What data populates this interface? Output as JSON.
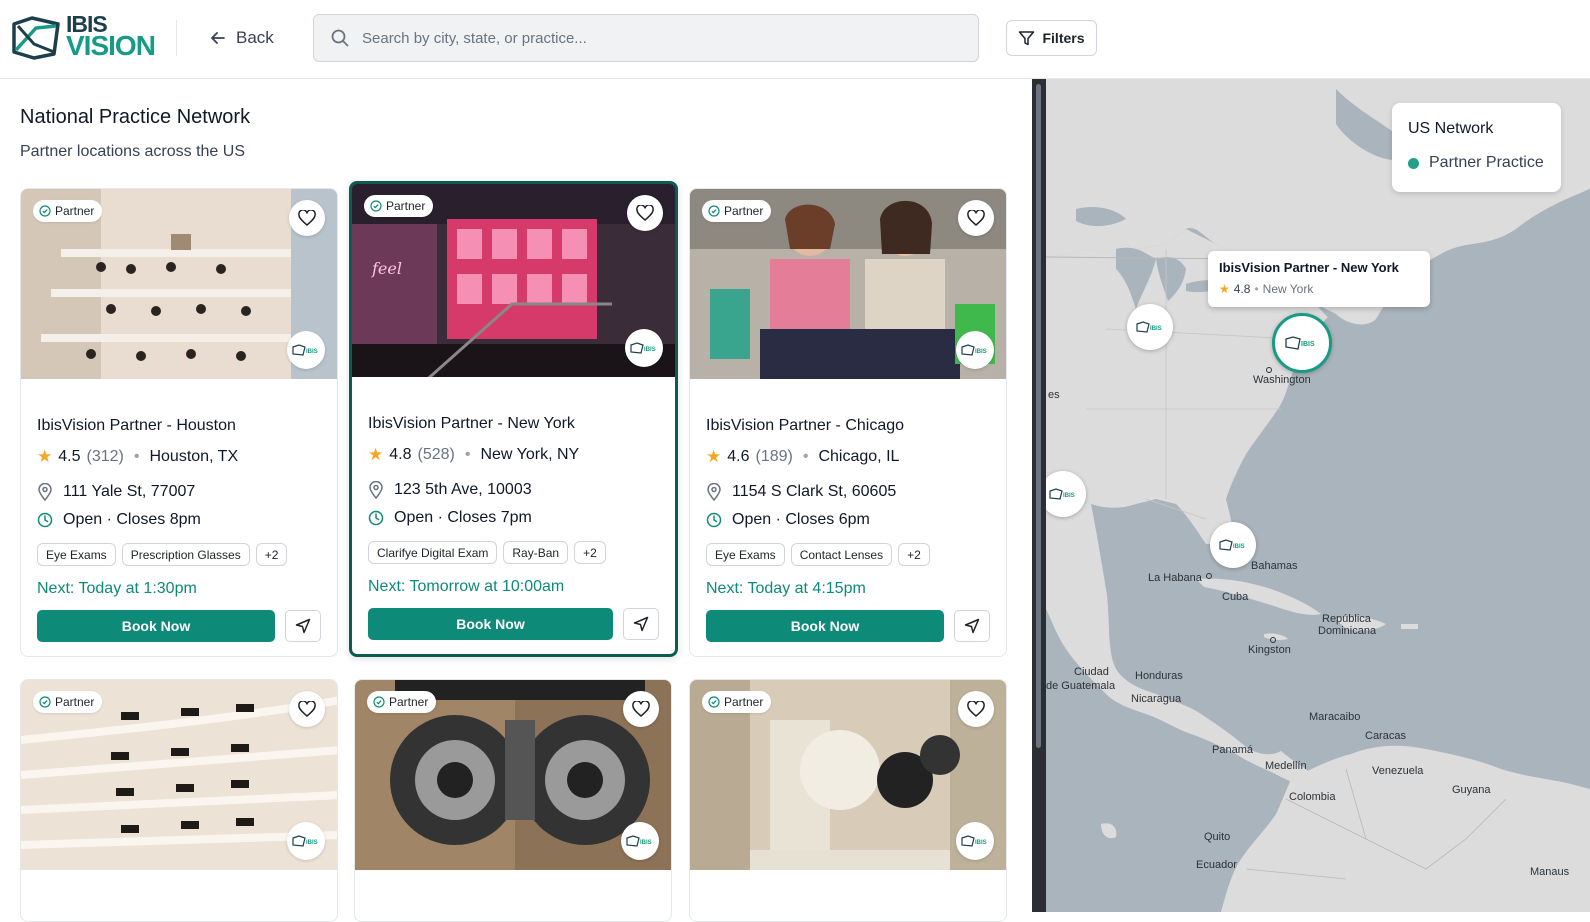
{
  "header": {
    "brand_line1": "IBIS",
    "brand_line2": "VISION",
    "back_label": "Back",
    "search_placeholder": "Search by city, state, or practice...",
    "filters_label": "Filters"
  },
  "page": {
    "title": "National Practice Network",
    "subtitle": "Partner locations across the US"
  },
  "cards": [
    {
      "badge": "Partner",
      "name": "IbisVision Partner - Houston",
      "rating": "4.5",
      "reviews": "(312)",
      "city": "Houston, TX",
      "address": "111 Yale St, 77007",
      "hours": "Open · Closes 8pm",
      "tags": [
        "Eye Exams",
        "Prescription Glasses",
        "+2"
      ],
      "next": "Next: Today at 1:30pm",
      "book_label": "Book Now"
    },
    {
      "badge": "Partner",
      "name": "IbisVision Partner - New York",
      "rating": "4.8",
      "reviews": "(528)",
      "city": "New York, NY",
      "address": "123 5th Ave, 10003",
      "hours": "Open · Closes 7pm",
      "tags": [
        "Clarifye Digital Exam",
        "Ray-Ban",
        "+2"
      ],
      "next": "Next: Tomorrow at 10:00am",
      "book_label": "Book Now"
    },
    {
      "badge": "Partner",
      "name": "IbisVision Partner - Chicago",
      "rating": "4.6",
      "reviews": "(189)",
      "city": "Chicago, IL",
      "address": "1154 S Clark St, 60605",
      "hours": "Open · Closes 6pm",
      "tags": [
        "Eye Exams",
        "Contact Lenses",
        "+2"
      ],
      "next": "Next: Today at 4:15pm",
      "book_label": "Book Now"
    },
    {
      "badge": "Partner"
    },
    {
      "badge": "Partner"
    },
    {
      "badge": "Partner"
    }
  ],
  "map": {
    "legend_title": "US Network",
    "legend_item": "Partner Practice",
    "tooltip": {
      "title": "IbisVision Partner - New York",
      "rating": "4.8",
      "location": "New York"
    },
    "labels": [
      "Washington",
      "La Habana",
      "Cuba",
      "Bahamas",
      "República",
      "Dominicana",
      "Kingston",
      "Ciudad",
      "de Guatemala",
      "Honduras",
      "Nicaragua",
      "Maracaibo",
      "Caracas",
      "Panamá",
      "Medellín",
      "Venezuela",
      "Colombia",
      "Guyana",
      "Quito",
      "Ecuador",
      "Manaus",
      "es"
    ]
  },
  "colors": {
    "brand": "#0e8a78",
    "selected_border": "#0b5d50",
    "star": "#f5a623",
    "map_water": "#aab4bc",
    "map_land": "#dcdcdc"
  }
}
